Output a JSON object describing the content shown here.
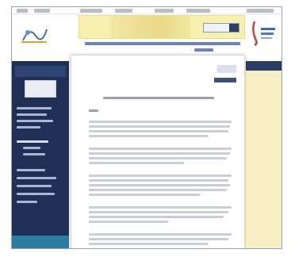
{
  "top_nav": {
    "items": [
      {
        "label": ""
      },
      {
        "label": ""
      },
      {
        "label": ""
      },
      {
        "label": ""
      },
      {
        "label": ""
      },
      {
        "label": ""
      },
      {
        "label": ""
      }
    ]
  },
  "header": {
    "site_title_line1": "",
    "site_title_line2": "",
    "search": {
      "placeholder": "",
      "button_label": ""
    },
    "left_logo_text": "",
    "right_logo_text": ""
  },
  "sidebar": {
    "heading": "",
    "menu": [
      {
        "label": ""
      },
      {
        "label": ""
      },
      {
        "label": ""
      },
      {
        "label": ""
      },
      {
        "label": ""
      },
      {
        "label": ""
      },
      {
        "label": ""
      },
      {
        "label": ""
      },
      {
        "label": ""
      },
      {
        "label": ""
      },
      {
        "label": ""
      },
      {
        "label": ""
      }
    ],
    "footer_label": ""
  },
  "content": {
    "breadcrumb": "",
    "back_link": "",
    "heading": "",
    "paragraphs": [
      "",
      "",
      "",
      "",
      ""
    ]
  },
  "right_panel": {
    "heading": ""
  },
  "colors": {
    "sidebar_bg": "#1f2f55",
    "sidebar_footer": "#2b7da4",
    "banner_bg": "#f7efb0",
    "right_panel_bg": "#f6efc4",
    "title_blue": "#6a80c8",
    "accent_dark": "#2d3f66"
  },
  "icons": {
    "left_logo": "site-logo-icon",
    "right_logo": "partner-logo-icon",
    "search": "search-icon"
  }
}
